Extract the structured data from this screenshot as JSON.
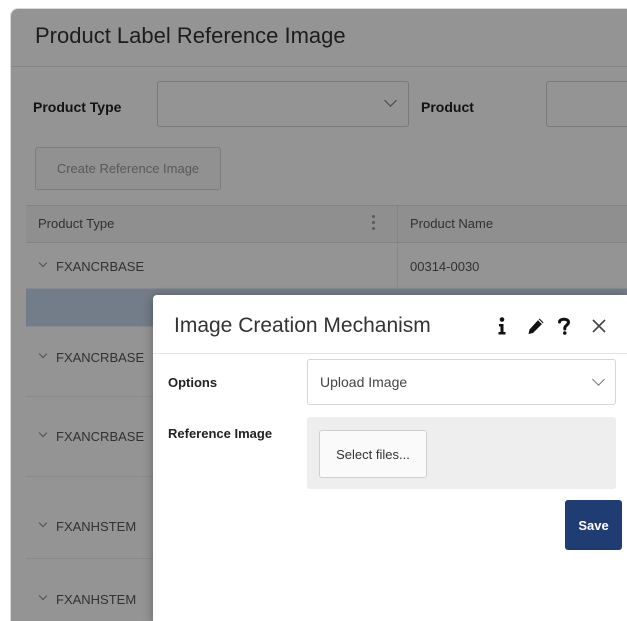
{
  "page": {
    "title": "Product Label Reference Image",
    "filters": {
      "product_type_label": "Product Type",
      "product_type_value": "",
      "product_label": "Product",
      "product_value": ""
    },
    "create_button": "Create Reference Image"
  },
  "grid": {
    "columns": [
      "Product Type",
      "Product Name"
    ],
    "rows": [
      {
        "type": "FXANCRBASE",
        "name": "00314-0030",
        "selected": false
      },
      {
        "type": "",
        "name": "",
        "selected": true
      },
      {
        "type": "FXANCRBASE",
        "name": "",
        "selected": false
      },
      {
        "type": "FXANCRBASE",
        "name": "",
        "selected": false
      },
      {
        "type": "FXANHSTEM",
        "name": "",
        "selected": false
      },
      {
        "type": "FXANHSTEM",
        "name": "",
        "selected": false
      }
    ]
  },
  "dialog": {
    "title": "Image Creation Mechanism",
    "icons": [
      "info-icon",
      "pencil-icon",
      "help-icon",
      "close-icon"
    ],
    "options_label": "Options",
    "options_value": "Upload Image",
    "reference_label": "Reference Image",
    "select_files": "Select files...",
    "save": "Save"
  },
  "colors": {
    "save_button": "#1f3d73",
    "selected_row": "#c7d6ec",
    "overlay": "rgba(0,0,0,0.42)"
  }
}
